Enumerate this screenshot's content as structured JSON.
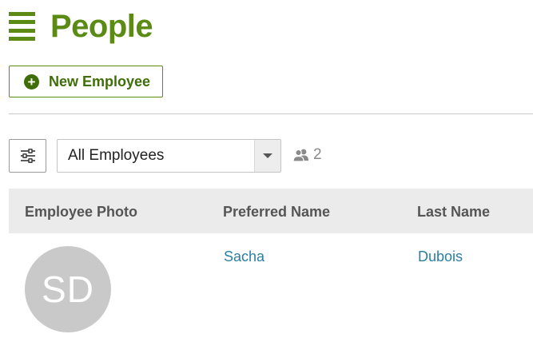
{
  "header": {
    "title": "People",
    "menu_icon": "hamburger-icon"
  },
  "toolbar": {
    "new_employee_label": "New Employee",
    "new_employee_icon": "plus-circle-icon"
  },
  "filter": {
    "icon": "sliders-icon",
    "selected_view": "All Employees",
    "employee_count": "2",
    "count_icon": "people-icon"
  },
  "table": {
    "columns": [
      "Employee Photo",
      "Preferred Name",
      "Last Name"
    ],
    "rows": [
      {
        "photo_initials": "SD",
        "preferred_name": "Sacha",
        "last_name": "Dubois"
      }
    ]
  },
  "colors": {
    "brand": "#5b8b14",
    "link": "#2a7fa3",
    "avatar_bg": "#c9c9c9"
  }
}
